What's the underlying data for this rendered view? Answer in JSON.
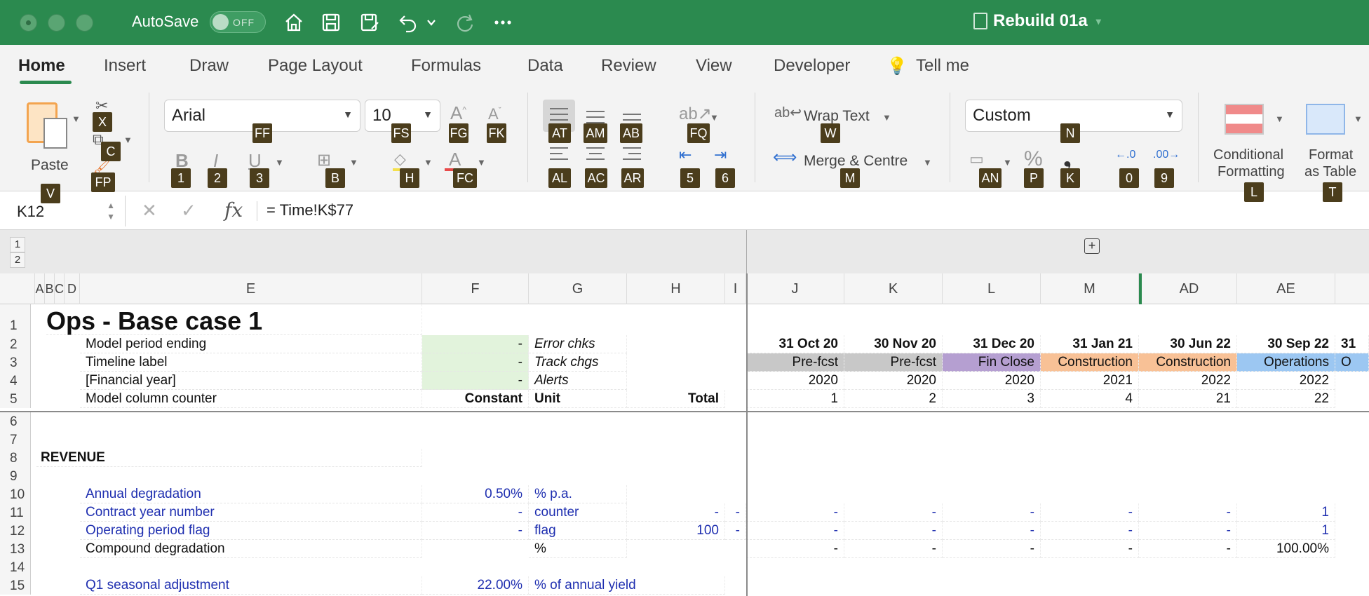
{
  "titlebar": {
    "autosave_label": "AutoSave",
    "autosave_state": "OFF",
    "doc_title": "Rebuild 01a"
  },
  "tabs": [
    "Home",
    "Insert",
    "Draw",
    "Page Layout",
    "Formulas",
    "Data",
    "Review",
    "View",
    "Developer",
    "Tell me"
  ],
  "ribbon": {
    "paste_label": "Paste",
    "font_name": "Arial",
    "font_size": "10",
    "wrap_text": "Wrap Text",
    "merge_centre": "Merge & Centre",
    "number_format": "Custom",
    "conditional_formatting_1": "Conditional",
    "conditional_formatting_2": "Formatting",
    "format_as_table_1": "Format",
    "format_as_table_2": "as Table",
    "keytips": {
      "cut": "X",
      "copy": "C",
      "format_painter": "FP",
      "paste": "V",
      "font_name": "FF",
      "font_size": "FS",
      "grow": "FG",
      "shrink": "FK",
      "bold": "1",
      "italic": "2",
      "underline": "3",
      "borders": "B",
      "fill": "H",
      "font_color": "FC",
      "align_top": "AT",
      "align_middle": "AM",
      "align_bottom": "AB",
      "orient": "FQ",
      "align_left": "AL",
      "align_center": "AC",
      "align_right": "AR",
      "dec_indent": "5",
      "inc_indent": "6",
      "wrap": "W",
      "merge": "M",
      "number_format": "N",
      "accounting": "AN",
      "percent": "P",
      "comma": "K",
      "inc_decimal": "0",
      "dec_decimal": "9",
      "cond_format": "L",
      "format_table": "T"
    }
  },
  "formula_bar": {
    "name_box": "K12",
    "formula": "= Time!K$77"
  },
  "outline_levels": [
    "1",
    "2"
  ],
  "columns": [
    "A",
    "B",
    "C",
    "D",
    "E",
    "F",
    "G",
    "H",
    "I",
    "J",
    "K",
    "L",
    "M",
    "AD",
    "AE"
  ],
  "rows": [
    {
      "n": "1",
      "title": "Ops - Base case 1"
    },
    {
      "n": "2",
      "label": "Model period ending",
      "f": "-",
      "g": "Error chks",
      "vals": [
        "31 Oct 20",
        "30 Nov 20",
        "31 Dec 20",
        "31 Jan 21",
        "30 Jun 22",
        "30 Sep 22",
        "31"
      ]
    },
    {
      "n": "3",
      "label": "Timeline label",
      "f": "-",
      "g": "Track chgs",
      "vals": [
        "Pre-fcst",
        "Pre-fcst",
        "Fin Close",
        "Construction",
        "Construction",
        "Operations",
        "O"
      ]
    },
    {
      "n": "4",
      "label": "[Financial year]",
      "f": "-",
      "g": "Alerts",
      "vals": [
        "2020",
        "2020",
        "2020",
        "2021",
        "2022",
        "2022"
      ]
    },
    {
      "n": "5",
      "label": "Model column counter",
      "f": "Constant",
      "g": "Unit",
      "h": "Total",
      "vals": [
        "1",
        "2",
        "3",
        "4",
        "21",
        "22"
      ]
    },
    {
      "n": "6"
    },
    {
      "n": "7"
    },
    {
      "n": "8",
      "section": "REVENUE"
    },
    {
      "n": "9"
    },
    {
      "n": "10",
      "label": "Annual degradation",
      "f": "0.50%",
      "g": "% p.a."
    },
    {
      "n": "11",
      "label": "Contract year number",
      "f": "-",
      "g": "counter",
      "h": "-",
      "i": "-",
      "vals": [
        "-",
        "-",
        "-",
        "-",
        "-",
        "1"
      ]
    },
    {
      "n": "12",
      "label": "Operating period flag",
      "f": "-",
      "g": "flag",
      "h": "100",
      "i": "-",
      "vals": [
        "-",
        "-",
        "-",
        "-",
        "-",
        "1"
      ]
    },
    {
      "n": "13",
      "label": "Compound degradation",
      "g": "%",
      "vals": [
        "-",
        "-",
        "-",
        "-",
        "-",
        "100.00%"
      ]
    },
    {
      "n": "14"
    },
    {
      "n": "15",
      "label": "Q1 seasonal adjustment",
      "f": "22.00%",
      "g": "% of annual yield"
    }
  ],
  "colors": {
    "brand": "#2b8a4f",
    "input_green": "#e2f3dc",
    "prefcst": "#c8c8c8",
    "finclose": "#b59fd1",
    "construction": "#f8c196",
    "operations": "#9cc7f2",
    "input_blue": "#1f2fb0",
    "keytip": "#4b3d1c"
  }
}
